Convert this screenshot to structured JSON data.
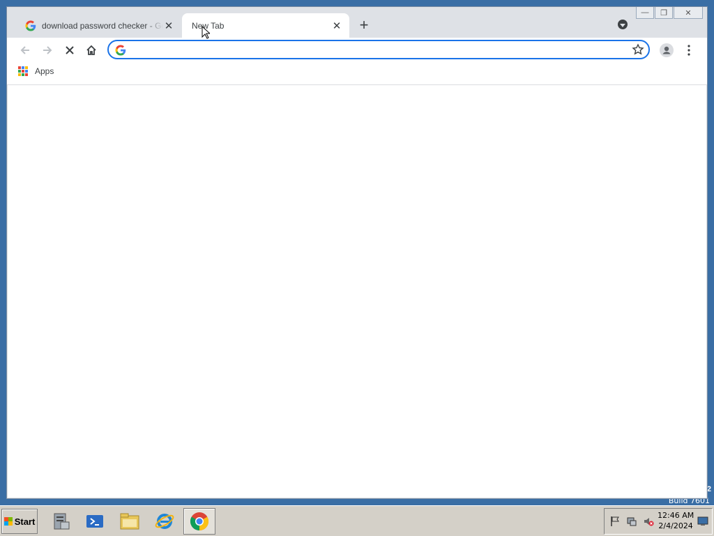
{
  "browser": {
    "tabs": [
      {
        "title": "download password checker - Google Search",
        "favicon": "google-g-icon",
        "active": false
      },
      {
        "title": "New Tab",
        "favicon": "",
        "active": true
      }
    ],
    "close_tab_glyph": "✕",
    "new_tab_glyph": "+",
    "toolbar": {
      "back_icon": "arrow-left-icon",
      "forward_icon": "arrow-right-icon",
      "stop_icon": "stop-x-icon",
      "home_icon": "home-icon",
      "profile_icon": "person-icon",
      "menu_icon": "three-dot-menu-icon"
    },
    "omnibox": {
      "value": "",
      "placeholder": "",
      "bookmark_icon": "star-icon"
    },
    "bookmarks_bar": {
      "items": [
        {
          "label": "Apps",
          "icon": "apps-grid-icon"
        }
      ]
    },
    "window_controls": {
      "minimize": "—",
      "maximize": "❐",
      "close": "✕"
    }
  },
  "desktop": {
    "build_text": "Build 7601",
    "corner_number": "2"
  },
  "taskbar": {
    "start_label": "Start",
    "apps": [
      {
        "name": "server-manager-icon"
      },
      {
        "name": "powershell-icon"
      },
      {
        "name": "file-explorer-icon"
      },
      {
        "name": "internet-explorer-icon"
      },
      {
        "name": "chrome-icon",
        "active": true
      }
    ],
    "tray_icons": [
      "flag-icon",
      "network-icon",
      "volume-muted-icon"
    ],
    "clock_time": "12:46 AM",
    "clock_date": "2/4/2024"
  },
  "colors": {
    "accent": "#1a73e8",
    "tabstrip": "#dee1e6",
    "desktop": "#3a6ea5",
    "taskbar": "#d4d0c8"
  }
}
